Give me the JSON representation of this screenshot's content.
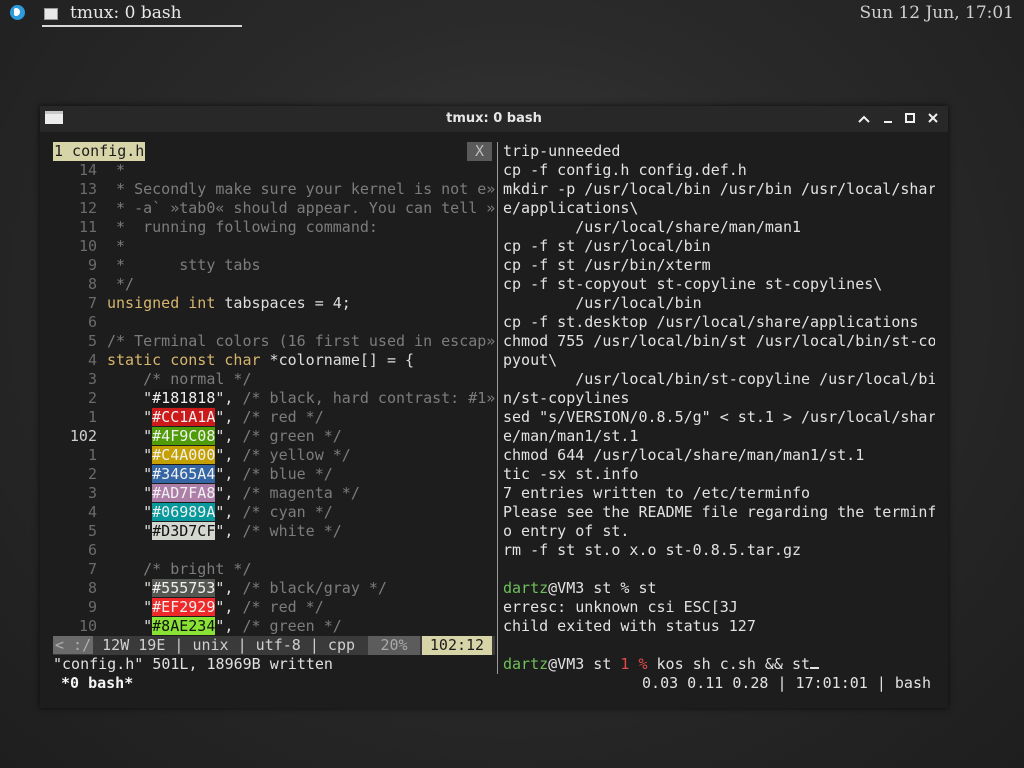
{
  "panel": {
    "taskbar_title": "tmux: 0 bash",
    "clock": "Sun 12 Jun, 17:01"
  },
  "window": {
    "title": "tmux: 0 bash",
    "buttons": [
      "minimize",
      "restore",
      "maximize",
      "close"
    ]
  },
  "vim": {
    "tab_label": "1 config.h",
    "tab_close": "X",
    "lines": [
      {
        "n": "14",
        "t": " *"
      },
      {
        "n": "13",
        "t": " * Secondly make sure your kernel is not e»"
      },
      {
        "n": "12",
        "t": " * -a` »tab0« should appear. You can tell »"
      },
      {
        "n": "11",
        "t": " *  running following command:"
      },
      {
        "n": "10",
        "t": " *"
      },
      {
        "n": "9",
        "t": " *      stty tabs"
      },
      {
        "n": "8",
        "t": " */"
      },
      {
        "n": "7",
        "kw": "unsigned int",
        "rest": " tabspaces = 4;"
      },
      {
        "n": "6",
        "t": ""
      },
      {
        "n": "5",
        "t": "/* Terminal colors (16 first used in escap»"
      },
      {
        "n": "4",
        "kw": "static const char",
        "rest": " *colorname[] = {"
      },
      {
        "n": "3",
        "t": "    /* normal */"
      },
      {
        "n": "2",
        "pre": "    \"",
        "hex": "#181818",
        "post": "\", ",
        "cmt": "/* black, hard contrast: #1»",
        "swatch": "#181818"
      },
      {
        "n": "1",
        "pre": "    \"",
        "hex": "#CC1A1A",
        "post": "\", ",
        "cmt": "/* red */",
        "swatch": "#CC1A1A"
      },
      {
        "n": "102",
        "pre": "    \"",
        "hex": "#4F9C08",
        "post": "\", ",
        "cmt": "/* green */",
        "swatch": "#4F9C08",
        "current": true
      },
      {
        "n": "1",
        "pre": "    \"",
        "hex": "#C4A000",
        "post": "\", ",
        "cmt": "/* yellow */",
        "swatch": "#C4A000"
      },
      {
        "n": "2",
        "pre": "    \"",
        "hex": "#3465A4",
        "post": "\", ",
        "cmt": "/* blue */",
        "swatch": "#3465A4"
      },
      {
        "n": "3",
        "pre": "    \"",
        "hex": "#AD7FA8",
        "post": "\", ",
        "cmt": "/* magenta */",
        "swatch": "#AD7FA8"
      },
      {
        "n": "4",
        "pre": "    \"",
        "hex": "#06989A",
        "post": "\", ",
        "cmt": "/* cyan */",
        "swatch": "#06989A"
      },
      {
        "n": "5",
        "pre": "    \"",
        "hex": "#D3D7CF",
        "post": "\", ",
        "cmt": "/* white */",
        "swatch": "#D3D7CF",
        "dark": true
      },
      {
        "n": "6",
        "t": ""
      },
      {
        "n": "7",
        "t": "    /* bright */"
      },
      {
        "n": "8",
        "pre": "    \"",
        "hex": "#555753",
        "post": "\", ",
        "cmt": "/* black/gray */",
        "swatch": "#555753"
      },
      {
        "n": "9",
        "pre": "    \"",
        "hex": "#EF2929",
        "post": "\", ",
        "cmt": "/* red */",
        "swatch": "#EF2929"
      },
      {
        "n": "10",
        "pre": "    \"",
        "hex": "#8AE234",
        "post": "\", ",
        "cmt": "/* green */",
        "swatch": "#8AE234",
        "dark": true
      }
    ],
    "status": {
      "mode": "< :/",
      "info": " 12W 19E | unix | utf-8 | cpp",
      "percent": "20%",
      "position": "102:12"
    },
    "message": "\"config.h\" 501L, 18969B written",
    "tmux_window": "*0 bash*"
  },
  "shell": {
    "lines": [
      "trip-unneeded",
      "cp -f config.h config.def.h",
      "mkdir -p /usr/local/bin /usr/bin /usr/local/shar",
      "e/applications\\",
      "        /usr/local/share/man/man1",
      "cp -f st /usr/local/bin",
      "cp -f st /usr/bin/xterm",
      "cp -f st-copyout st-copyline st-copylines\\",
      "        /usr/local/bin",
      "cp -f st.desktop /usr/local/share/applications",
      "chmod 755 /usr/local/bin/st /usr/local/bin/st-co",
      "pyout\\",
      "        /usr/local/bin/st-copyline /usr/local/bi",
      "n/st-copylines",
      "sed \"s/VERSION/0.8.5/g\" < st.1 > /usr/local/shar",
      "e/man/man1/st.1",
      "chmod 644 /usr/local/share/man/man1/st.1",
      "tic -sx st.info",
      "7 entries written to /etc/terminfo",
      "Please see the README file regarding the terminf",
      "o entry of st.",
      "rm -f st st.o x.o st-0.8.5.tar.gz",
      ""
    ],
    "prompt1": {
      "user": "dartz",
      "host": "@VM3 st % ",
      "cmd": "st"
    },
    "after_prompt": [
      "erresc: unknown csi ESC[3J",
      "child exited with status 127",
      ""
    ],
    "prompt2": {
      "user": "dartz",
      "host": "@VM3 st ",
      "code": "1",
      "sym": " %",
      "cmd": " kos sh c.sh && st"
    },
    "tmux_status": "0.03 0.11 0.28 | 17:01:01 | bash"
  }
}
